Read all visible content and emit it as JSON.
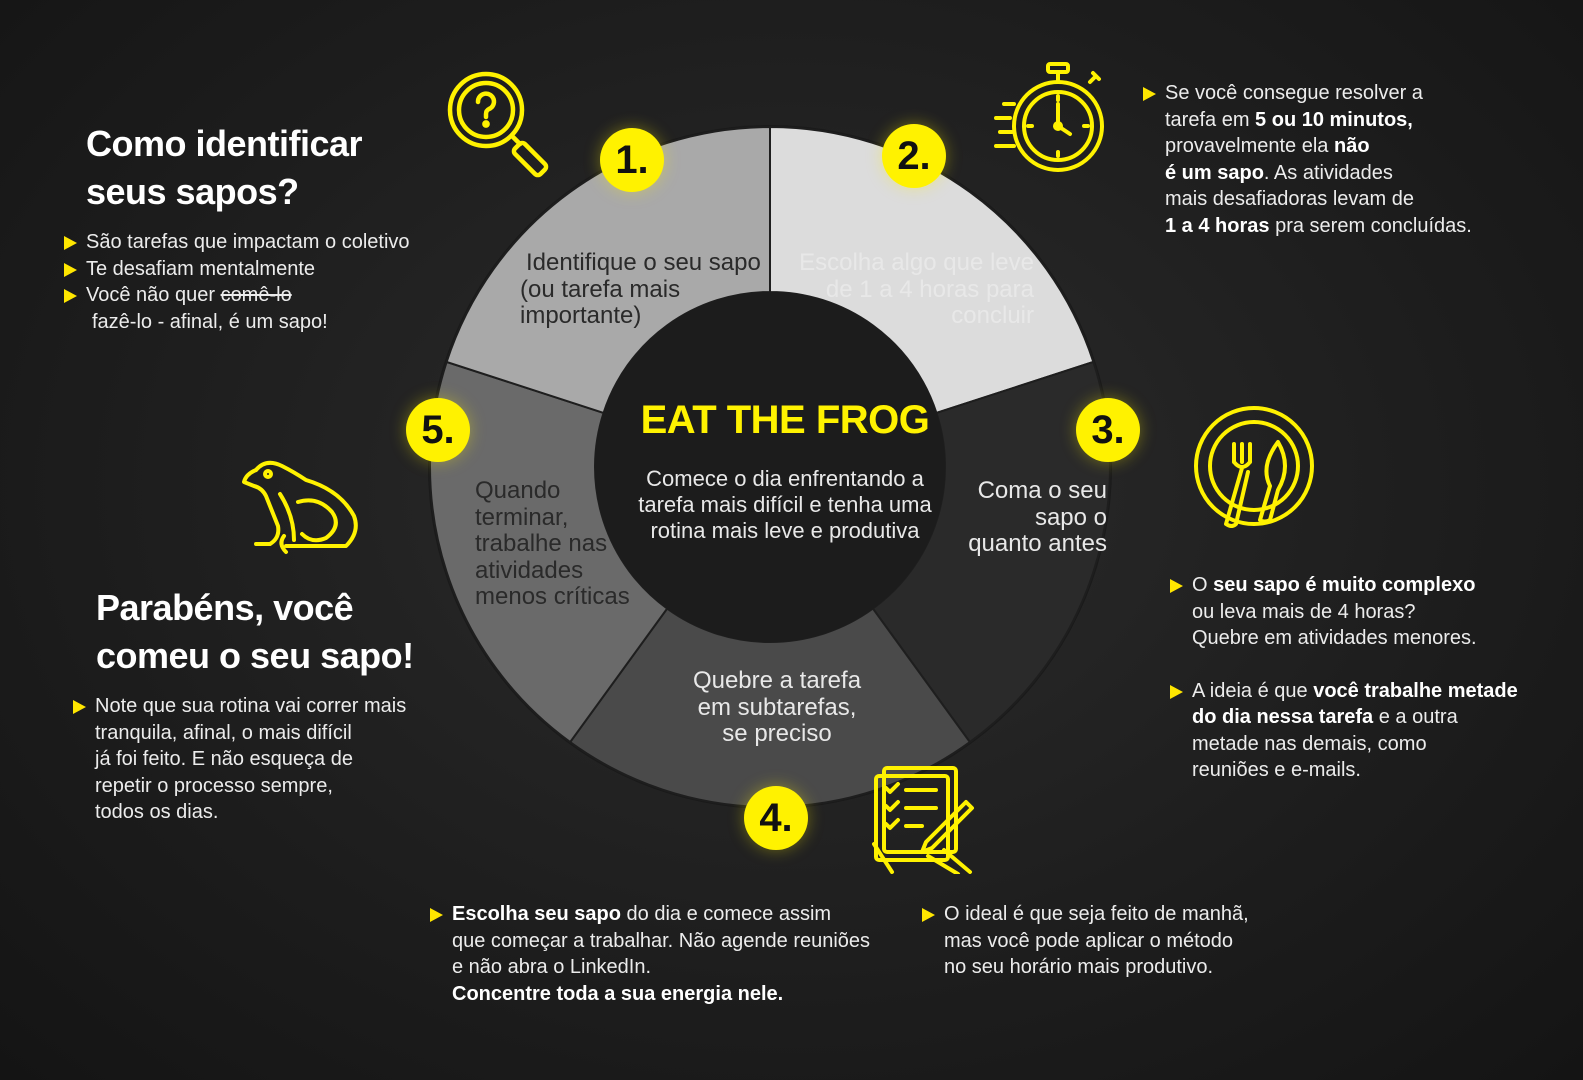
{
  "colors": {
    "accent": "#fff200",
    "background": "#1e1e1e"
  },
  "identify": {
    "title_line1": "Como identificar",
    "title_line2": "seus sapos?",
    "bullets": [
      "São tarefas que impactam o coletivo",
      "Te desafiam mentalmente",
      "Você não quer "
    ],
    "strikethrough": "comê-lo",
    "continuation": "fazê-lo - afinal, é um sapo!"
  },
  "congrats": {
    "title_line1": "Parabéns, você",
    "title_line2": "comeu o seu sapo!",
    "note_lines": [
      "Note que sua rotina vai correr mais",
      "tranquila, afinal, o mais difícil",
      "já foi feito. E não esqueça de",
      "repetir o processo sempre,",
      "todos os dias."
    ]
  },
  "wheel": {
    "center_title": "EAT THE FROG",
    "center_subtitle_lines": [
      "Comece o dia enfrentando a",
      "tarefa mais difícil e tenha uma",
      "rotina mais leve e produtiva"
    ],
    "steps": [
      {
        "number": "1.",
        "lines": [
          "Identifique o seu sapo",
          "(ou tarefa mais",
          "importante)"
        ],
        "color": "#dcdcdc"
      },
      {
        "number": "2.",
        "lines": [
          "Escolha algo que leve",
          "de 1 a 4 horas para",
          "concluir"
        ],
        "color": "#2a2a2a"
      },
      {
        "number": "3.",
        "lines": [
          "Coma o seu",
          "sapo o",
          "quanto antes"
        ],
        "color": "#4a4a4a"
      },
      {
        "number": "4.",
        "lines": [
          "Quebre a tarefa",
          "em subtarefas,",
          "se preciso"
        ],
        "color": "#6a6a6a"
      },
      {
        "number": "5.",
        "lines": [
          "Quando",
          "terminar,",
          "trabalhe nas",
          "atividades",
          "menos críticas"
        ],
        "color": "#a9a9a9"
      }
    ]
  },
  "tip_time": {
    "line1": "Se você consegue resolver a",
    "line2_pre": "tarefa em ",
    "line2_bold": "5 ou 10 minutos,",
    "line3_pre": "provavelmente ela ",
    "line3_bold": "não",
    "line4_bold": "é um sapo",
    "line4_post": ". As atividades",
    "line5": "mais desafiadoras levam de",
    "line6_bold": "1 a 4 horas",
    "line6_post": " pra serem concluídas."
  },
  "tip_complex": {
    "b1_pre": "O ",
    "b1_bold": "seu sapo é muito complexo",
    "b1_line2": "ou leva mais de 4 horas?",
    "b1_line3": "Quebre em atividades menores.",
    "b2_pre": "A ideia é que ",
    "b2_bold1": "você trabalhe metade",
    "b2_bold2": "do dia nessa tarefa",
    "b2_post": " e a outra",
    "b2_line3": "metade nas demais, como",
    "b2_line4": "reuniões e e-mails."
  },
  "tip_choose": {
    "bold1": "Escolha seu sapo",
    "text1": " do dia e comece assim",
    "line2": "que começar a trabalhar. Não agende reuniões",
    "line3": "e não abra o LinkedIn.",
    "bold_last": "Concentre toda a sua energia nele."
  },
  "tip_morning": {
    "lines": [
      "O ideal é que seja feito de manhã,",
      "mas você pode aplicar o método",
      "no seu horário mais produtivo."
    ]
  },
  "icons": [
    "magnifier-question-icon",
    "stopwatch-icon",
    "plate-cutlery-icon",
    "checklist-pen-icon",
    "frog-icon"
  ]
}
